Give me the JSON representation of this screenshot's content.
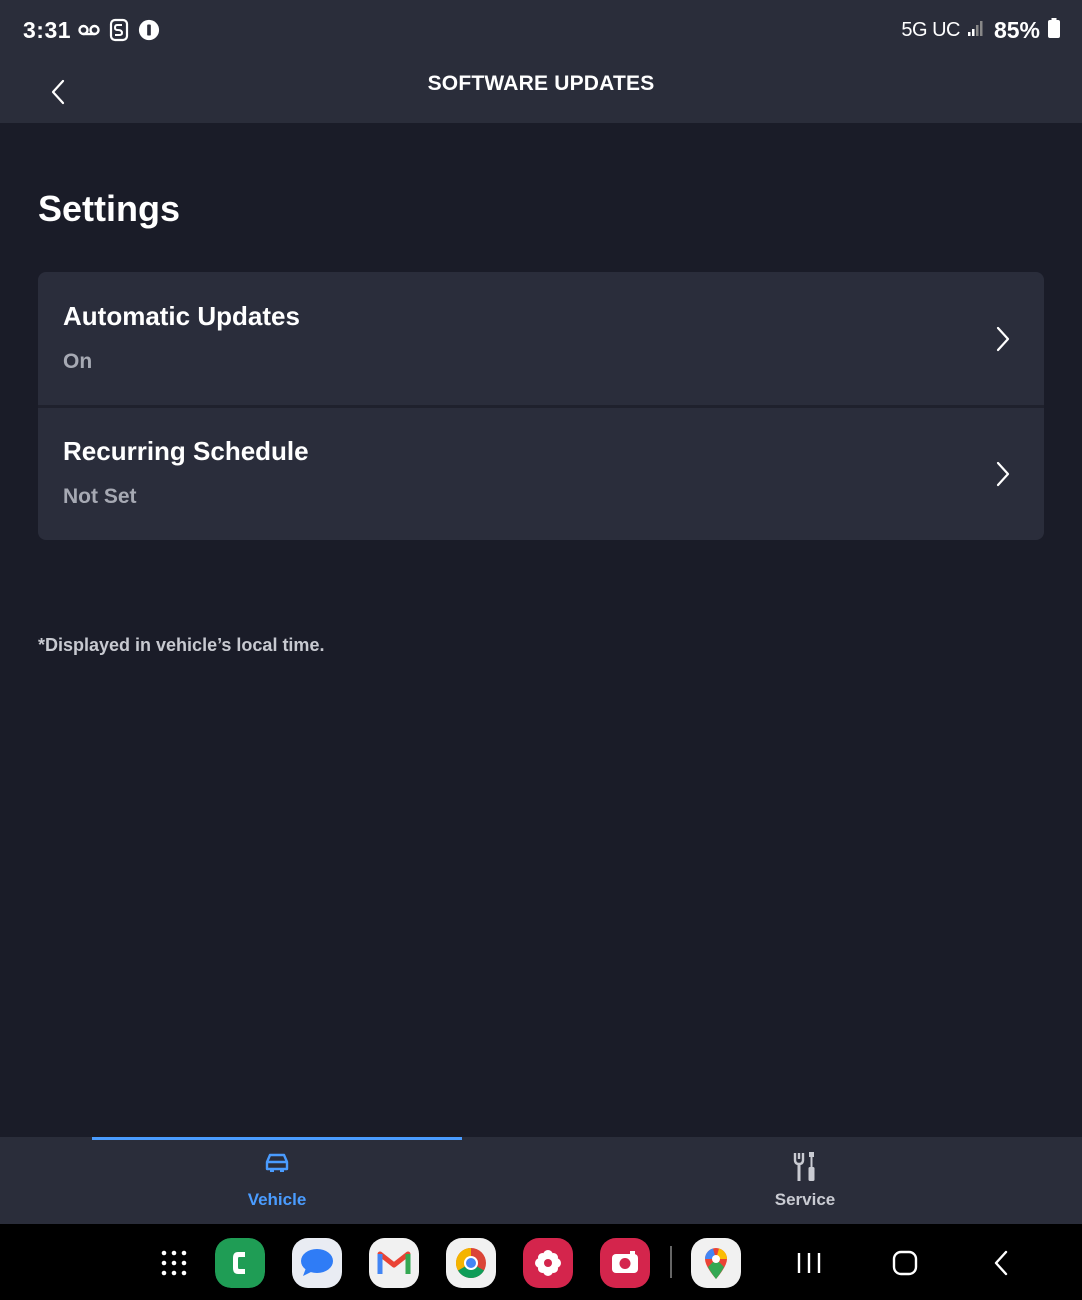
{
  "status_bar": {
    "time": "3:31",
    "network": "5G UC",
    "battery": "85%"
  },
  "header": {
    "title": "SOFTWARE UPDATES"
  },
  "page": {
    "section_title": "Settings",
    "settings": [
      {
        "label": "Automatic Updates",
        "value": "On"
      },
      {
        "label": "Recurring Schedule",
        "value": "Not Set"
      }
    ],
    "footnote": "*Displayed in vehicle’s local time."
  },
  "tabs": [
    {
      "label": "Vehicle",
      "active": true
    },
    {
      "label": "Service",
      "active": false
    }
  ],
  "colors": {
    "accent": "#4a9cff",
    "background": "#1a1c28",
    "surface": "#2a2d3b"
  },
  "nav_bar": {
    "apps": [
      "app-drawer",
      "phone",
      "messages",
      "gmail",
      "chrome",
      "gallery",
      "camera",
      "maps"
    ],
    "system": [
      "recents",
      "home",
      "back"
    ]
  }
}
